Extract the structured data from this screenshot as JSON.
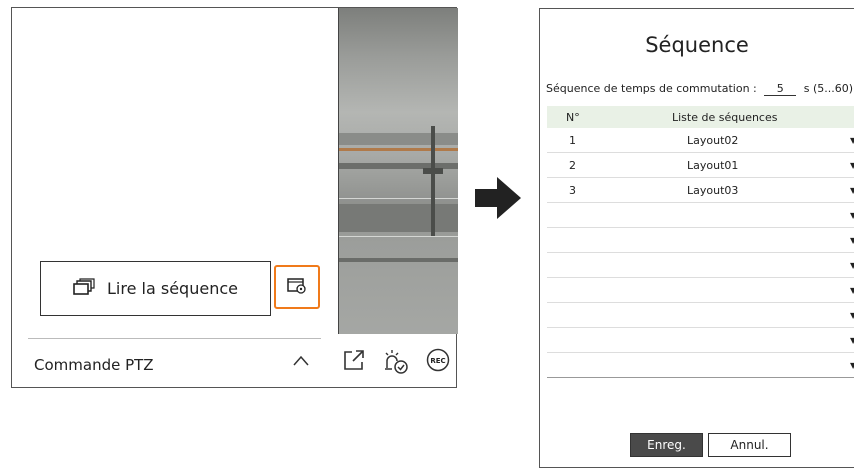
{
  "left_panel": {
    "play_sequence_label": "Lire la séquence",
    "ptz_label": "Commande PTZ",
    "icons": [
      "windows-stack-icon",
      "sequence-settings-icon",
      "chevron-up-icon",
      "export-icon",
      "alarm-check-icon",
      "rec-icon"
    ],
    "rec_label": "REC",
    "accent_color": "#f07a1a"
  },
  "dialog": {
    "title": "Séquence",
    "interval_label": "Séquence de temps de commutation :",
    "interval_value": "5",
    "interval_unit": "s (5...60)",
    "columns": [
      "N°",
      "Liste de séquences"
    ],
    "rows": [
      {
        "num": "1",
        "layout": "Layout02"
      },
      {
        "num": "2",
        "layout": "Layout01"
      },
      {
        "num": "3",
        "layout": "Layout03"
      },
      {
        "num": "",
        "layout": ""
      },
      {
        "num": "",
        "layout": ""
      },
      {
        "num": "",
        "layout": ""
      },
      {
        "num": "",
        "layout": ""
      },
      {
        "num": "",
        "layout": ""
      },
      {
        "num": "",
        "layout": ""
      },
      {
        "num": "",
        "layout": ""
      }
    ],
    "save_label": "Enreg.",
    "cancel_label": "Annul.",
    "header_color": "#e9f1e6",
    "save_color": "#4a4a4a"
  }
}
